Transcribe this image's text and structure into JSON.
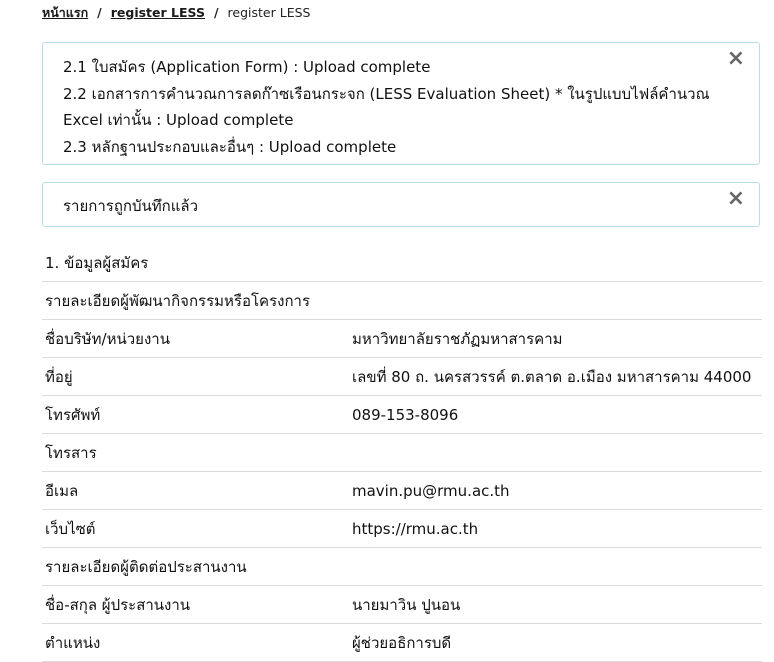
{
  "breadcrumb": {
    "home": "หน้าแรก",
    "sep1": "/",
    "register_link": "register LESS",
    "sep2": "/",
    "current": "register LESS"
  },
  "upload_alert": {
    "close": "×",
    "lines": [
      "2.1 ใบสมัคร (Application Form) : Upload complete",
      "2.2 เอกสารการคำนวณการลดก๊าซเรือนกระจก (LESS Evaluation Sheet) * ในรูปแบบไฟล์คำนวณ",
      "Excel เท่านั้น : Upload complete",
      "2.3 หลักฐานประกอบและอื่นๆ : Upload complete"
    ]
  },
  "saved_alert": {
    "close": "×",
    "message": "รายการถูกบันทึกแล้ว"
  },
  "info": {
    "section_title": "1. ข้อมูลผู้สมัคร",
    "developer_heading": "รายละเอียดผู้พัฒนากิจกรรมหรือโครงการ",
    "rows": [
      {
        "label": "ชื่อบริษัท/หน่วยงาน",
        "value": "มหาวิทยาลัยราชภัฏมหาสารคาม"
      },
      {
        "label": "ที่อยู่",
        "value": "เลขที่ 80 ถ. นครสวรรค์ ต.ตลาด อ.เมือง มหาสารคาม 44000"
      },
      {
        "label": "โทรศัพท์",
        "value": "089-153-8096"
      },
      {
        "label": "โทรสาร",
        "value": ""
      },
      {
        "label": "อีเมล",
        "value": "mavin.pu@rmu.ac.th"
      },
      {
        "label": "เว็บไซต์",
        "value": "https://rmu.ac.th"
      }
    ],
    "coordinator_heading": "รายละเอียดผู้ติดต่อประสานงาน",
    "coordinator_rows": [
      {
        "label": "ชื่อ-สกุล ผู้ประสานงาน",
        "value": "นายมาวิน ปูนอน"
      },
      {
        "label": "ตำแหน่ง",
        "value": "ผู้ช่วยอธิการบดี"
      }
    ]
  }
}
